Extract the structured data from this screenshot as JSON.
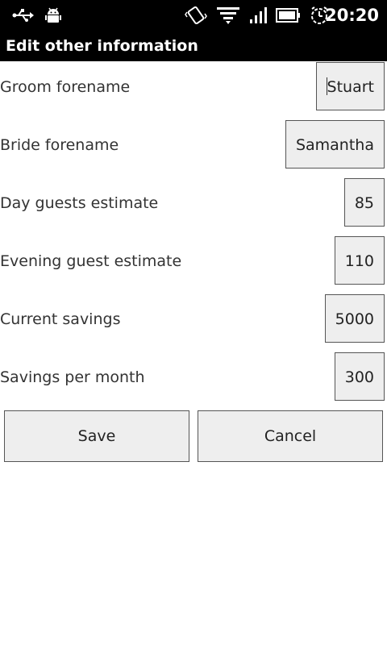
{
  "status_bar": {
    "time": "20:20",
    "icons": [
      "usb-icon",
      "android-debug-icon",
      "vibrate-icon",
      "wifi-icon",
      "signal-icon",
      "battery-icon",
      "alarm-icon"
    ]
  },
  "title_bar": {
    "title": "Edit other information"
  },
  "form": {
    "fields": [
      {
        "label": "Groom forename",
        "value": "Stuart"
      },
      {
        "label": "Bride forename",
        "value": "Samantha"
      },
      {
        "label": "Day guests estimate",
        "value": "85"
      },
      {
        "label": "Evening guest estimate",
        "value": "110"
      },
      {
        "label": "Current savings",
        "value": "5000"
      },
      {
        "label": "Savings per month",
        "value": "300"
      }
    ]
  },
  "buttons": {
    "save_label": "Save",
    "cancel_label": "Cancel"
  },
  "colors": {
    "bar_background": "#000000",
    "field_background": "#eeeeee",
    "field_border": "#555555",
    "label_text": "#333333"
  }
}
